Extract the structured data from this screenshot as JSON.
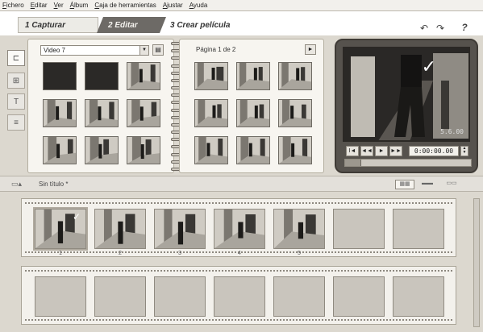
{
  "menu": [
    "Fichero",
    "Editar",
    "Ver",
    "Álbum",
    "Caja de herramientas",
    "Ajustar",
    "Ayuda"
  ],
  "tabs": [
    {
      "label": "1 Capturar"
    },
    {
      "label": "2 Editar"
    },
    {
      "label": "3 Crear película"
    }
  ],
  "toolbar_icons": {
    "undo": "↶",
    "redo": "↷",
    "help": "?"
  },
  "album": {
    "source_select": "Video 7",
    "page_label": "Página 1 de 2",
    "left_thumbnail_count": 9,
    "right_thumbnail_count": 9
  },
  "player": {
    "timecode": "0:00:00.00",
    "overlay_timecode": "5.6.00",
    "buttons": {
      "rewind": "I◄",
      "back": "◄◄",
      "play": "►",
      "forward": "►►"
    },
    "scrub_position": 0.0
  },
  "movie": {
    "title": "Sin título *",
    "clips": [
      {
        "number": "1",
        "selected": true
      },
      {
        "number": "2"
      },
      {
        "number": "3"
      },
      {
        "number": "4"
      },
      {
        "number": "5"
      },
      {
        "number": ""
      },
      {
        "number": ""
      }
    ],
    "empty_slots_row2": 7
  },
  "colors": {
    "edit_tab_bg": "#6d6a66",
    "app_bg": "#dcd8cf"
  }
}
